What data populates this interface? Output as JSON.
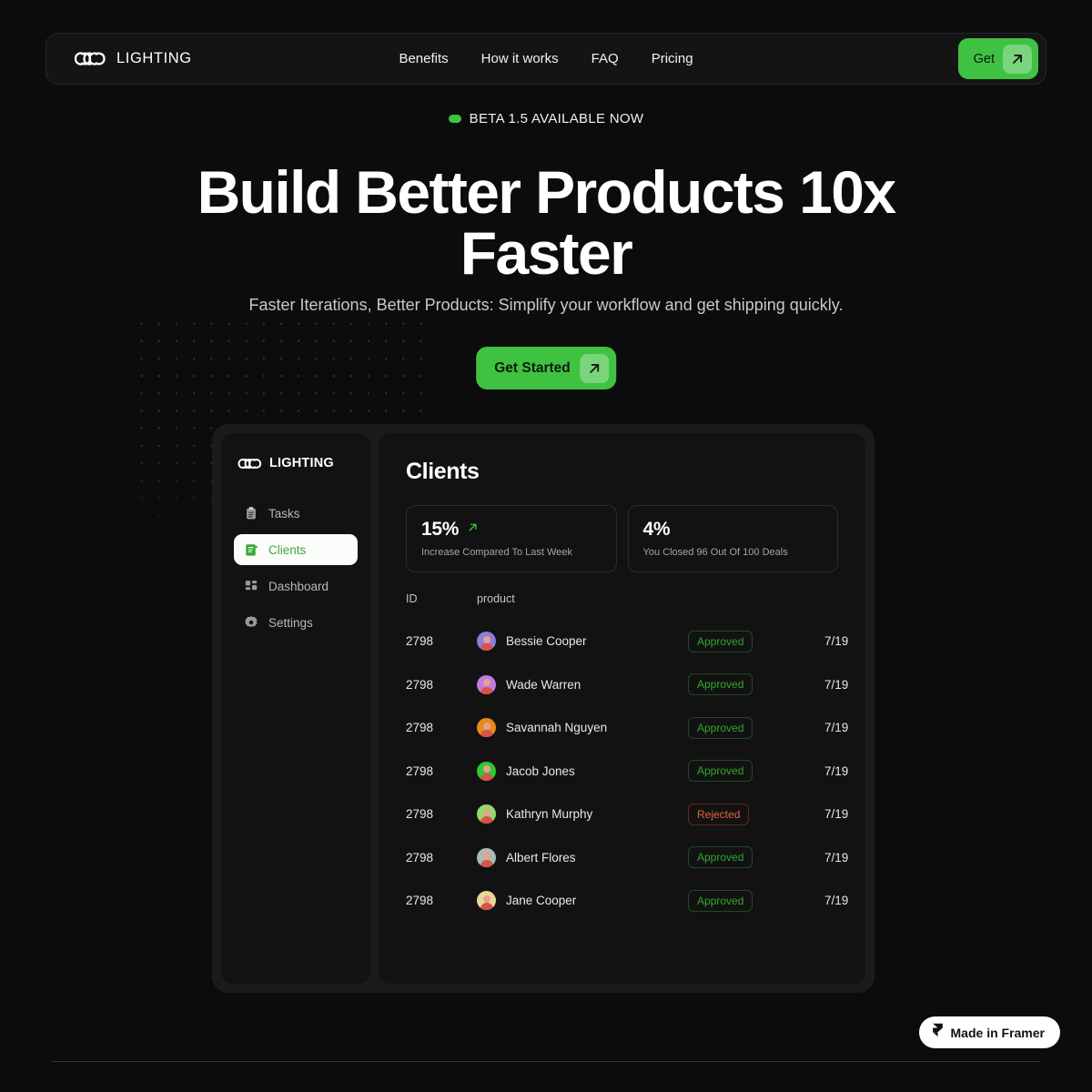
{
  "nav": {
    "brand": "LIGHTING",
    "brand_icon": "infinity-chain-logo",
    "links": [
      {
        "label": "Benefits"
      },
      {
        "label": "How it works"
      },
      {
        "label": "FAQ"
      },
      {
        "label": "Pricing"
      }
    ],
    "cta_label": "Get",
    "cta_icon": "arrow-up-right-icon",
    "accent": "#3fc242"
  },
  "hero": {
    "badge_text": "BETA 1.5 AVAILABLE NOW",
    "badge_dot_color": "#3fc242",
    "title": "Build Better Products 10x Faster",
    "subtitle": "Faster Iterations, Better Products: Simplify your workflow and get shipping quickly.",
    "cta_label": "Get Started",
    "cta_icon": "arrow-up-right-icon"
  },
  "dashboard": {
    "sidebar": {
      "brand": "LIGHTING",
      "items": [
        {
          "label": "Tasks",
          "icon": "clipboard-icon",
          "active": false
        },
        {
          "label": "Clients",
          "icon": "scroll-document-icon",
          "active": true
        },
        {
          "label": "Dashboard",
          "icon": "grid-icon",
          "active": false
        },
        {
          "label": "Settings",
          "icon": "gear-icon",
          "active": false
        }
      ]
    },
    "title": "Clients",
    "stats": [
      {
        "value": "15%",
        "icon": "trend-up-arrow-icon",
        "description": "Increase Compared To Last Week"
      },
      {
        "value": "4%",
        "icon": "",
        "description": "You Closed 96 Out Of 100 Deals"
      }
    ],
    "table": {
      "headers": [
        "ID",
        "product",
        "",
        ""
      ],
      "rows": [
        {
          "id": "2798",
          "name": "Bessie Cooper",
          "avatar_color": "#8b7fd4",
          "status": "Approved",
          "date": "7/19"
        },
        {
          "id": "2798",
          "name": "Wade Warren",
          "avatar_color": "#c07ae0",
          "status": "Approved",
          "date": "7/19"
        },
        {
          "id": "2798",
          "name": "Savannah Nguyen",
          "avatar_color": "#e8891a",
          "status": "Approved",
          "date": "7/19"
        },
        {
          "id": "2798",
          "name": "Jacob Jones",
          "avatar_color": "#30c830",
          "status": "Approved",
          "date": "7/19"
        },
        {
          "id": "2798",
          "name": "Kathryn Murphy",
          "avatar_color": "#93d96a",
          "status": "Rejected",
          "date": "7/19"
        },
        {
          "id": "2798",
          "name": "Albert Flores",
          "avatar_color": "#a8bcb4",
          "status": "Approved",
          "date": "7/19"
        },
        {
          "id": "2798",
          "name": "Jane Cooper",
          "avatar_color": "#ead79a",
          "status": "Approved",
          "date": "7/19"
        }
      ]
    }
  },
  "footer": {
    "framer_label": "Made in Framer",
    "framer_icon": "framer-logo-icon"
  }
}
